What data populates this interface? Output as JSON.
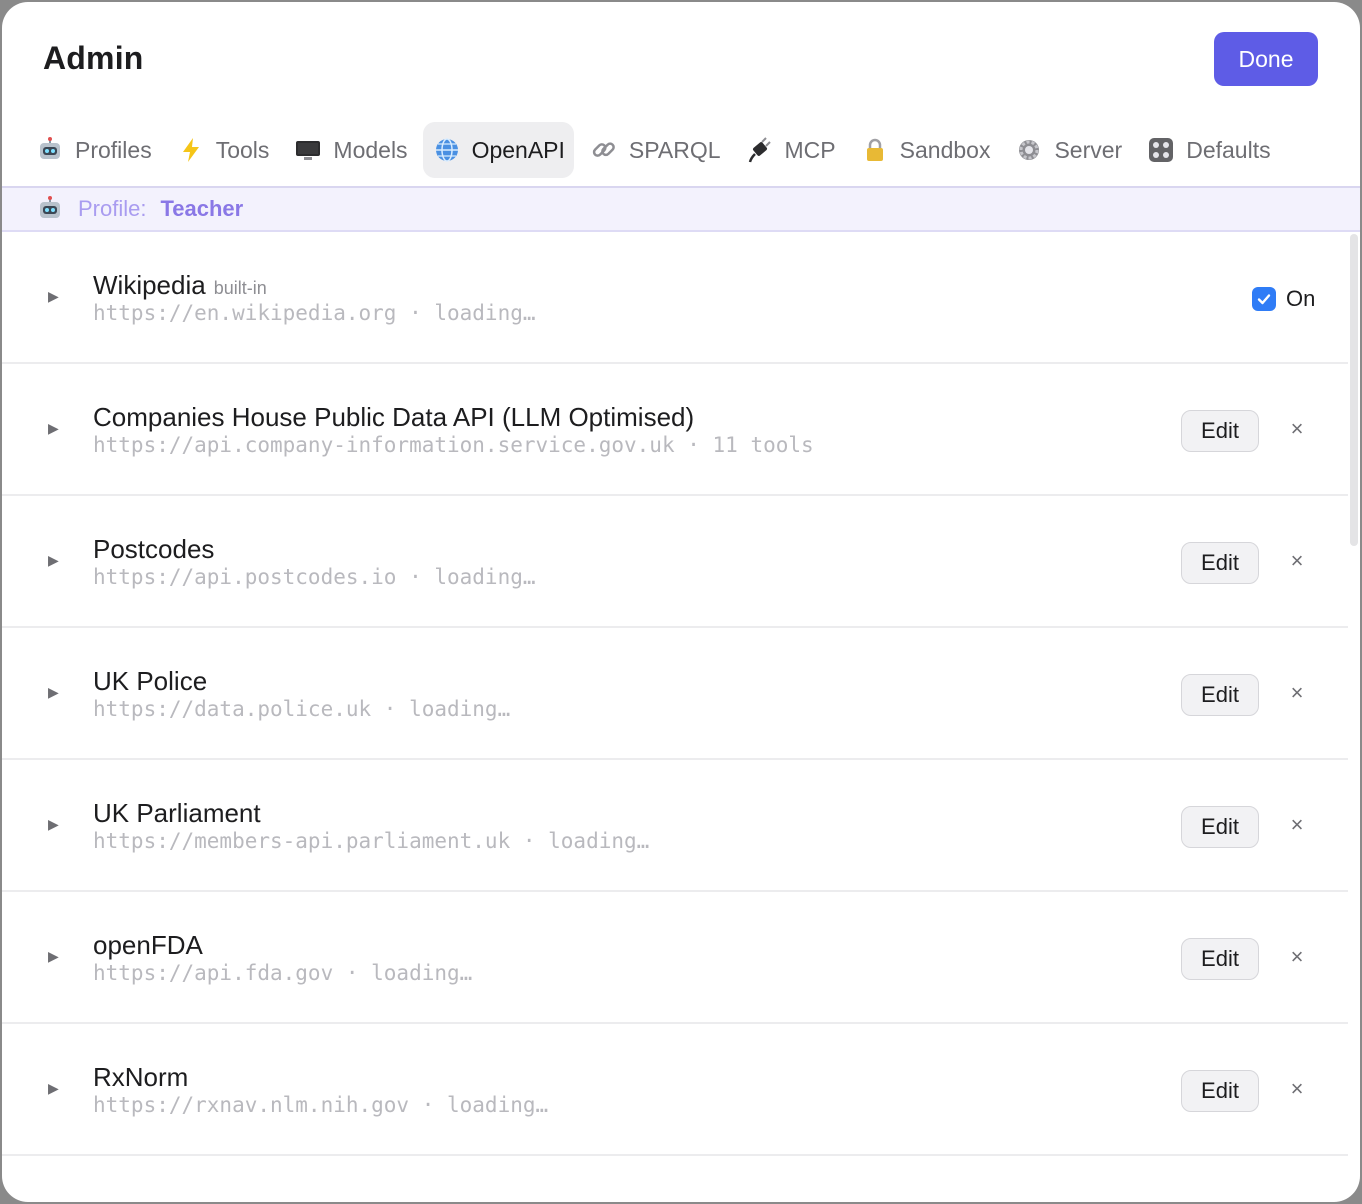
{
  "header": {
    "title": "Admin",
    "done_label": "Done"
  },
  "tabs": [
    {
      "label": "Profiles",
      "icon": "robot-icon",
      "active": false
    },
    {
      "label": "Tools",
      "icon": "lightning-icon",
      "active": false
    },
    {
      "label": "Models",
      "icon": "monitor-icon",
      "active": false
    },
    {
      "label": "OpenAPI",
      "icon": "globe-icon",
      "active": true
    },
    {
      "label": "SPARQL",
      "icon": "link-icon",
      "active": false
    },
    {
      "label": "MCP",
      "icon": "plug-icon",
      "active": false
    },
    {
      "label": "Sandbox",
      "icon": "lock-icon",
      "active": false
    },
    {
      "label": "Server",
      "icon": "gear-icon",
      "active": false
    },
    {
      "label": "Defaults",
      "icon": "control-knobs-icon",
      "active": false
    }
  ],
  "profile": {
    "label": "Profile:",
    "name": "Teacher"
  },
  "apis": [
    {
      "title": "Wikipedia",
      "tag": "built-in",
      "subtitle": "https://en.wikipedia.org · loading…",
      "builtin": true,
      "toggle_label": "On",
      "enabled": true
    },
    {
      "title": "Companies House Public Data API (LLM Optimised)",
      "subtitle": "https://api.company-information.service.gov.uk · 11 tools",
      "edit_label": "Edit",
      "close": "×"
    },
    {
      "title": "Postcodes",
      "subtitle": "https://api.postcodes.io · loading…",
      "edit_label": "Edit",
      "close": "×"
    },
    {
      "title": "UK Police",
      "subtitle": "https://data.police.uk · loading…",
      "edit_label": "Edit",
      "close": "×"
    },
    {
      "title": "UK Parliament",
      "subtitle": "https://members-api.parliament.uk · loading…",
      "edit_label": "Edit",
      "close": "×"
    },
    {
      "title": "openFDA",
      "subtitle": "https://api.fda.gov · loading…",
      "edit_label": "Edit",
      "close": "×"
    },
    {
      "title": "RxNorm",
      "subtitle": "https://rxnav.nlm.nih.gov · loading…",
      "edit_label": "Edit",
      "close": "×"
    }
  ],
  "caret": "▶",
  "colors": {
    "accent": "#5e5ce6",
    "profile_name": "#8a78e6",
    "checkbox": "#2f7cf6"
  }
}
